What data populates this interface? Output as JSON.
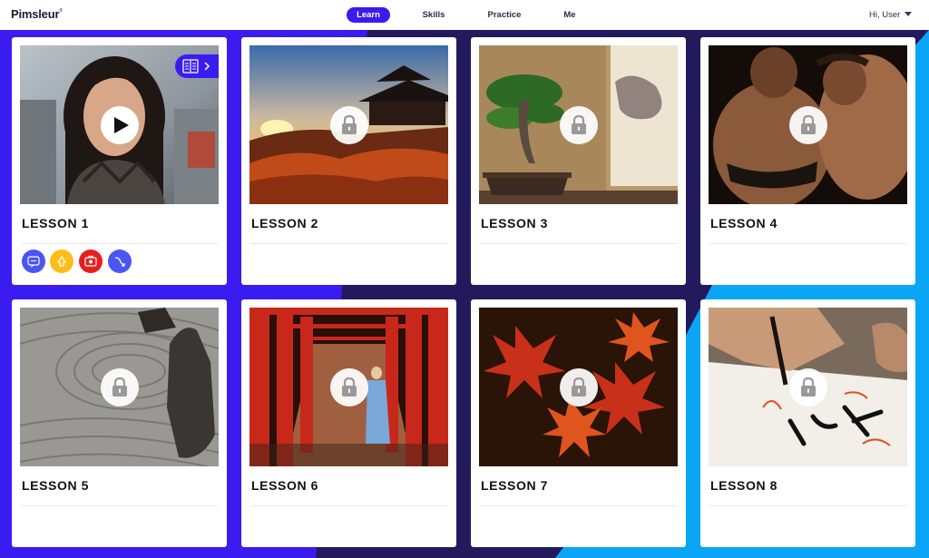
{
  "app": {
    "logo": "Pimsleur",
    "logo_mark": "®"
  },
  "nav": {
    "items": [
      {
        "label": "Learn",
        "active": true
      },
      {
        "label": "Skills",
        "active": false
      },
      {
        "label": "Practice",
        "active": false
      },
      {
        "label": "Me",
        "active": false
      }
    ]
  },
  "user": {
    "greeting": "Hi, User"
  },
  "colors": {
    "accent": "#3a1cf0",
    "background_violet": "#3a1cf0",
    "background_navy": "#231a5e",
    "background_sky": "#0aa5f5"
  },
  "lessons": [
    {
      "title": "LESSON 1",
      "status": "unlocked",
      "image": "woman-portrait",
      "overlay_icon": "play-icon",
      "tab_icon": "reading-icon"
    },
    {
      "title": "LESSON 2",
      "status": "locked",
      "image": "temple-at-sunset",
      "overlay_icon": "lock-icon"
    },
    {
      "title": "LESSON 3",
      "status": "locked",
      "image": "bonsai-tree",
      "overlay_icon": "lock-icon"
    },
    {
      "title": "LESSON 4",
      "status": "locked",
      "image": "sumo-wrestlers",
      "overlay_icon": "lock-icon"
    },
    {
      "title": "LESSON 5",
      "status": "locked",
      "image": "zen-rock-garden",
      "overlay_icon": "lock-icon"
    },
    {
      "title": "LESSON 6",
      "status": "locked",
      "image": "torii-gate-path",
      "overlay_icon": "lock-icon"
    },
    {
      "title": "LESSON 7",
      "status": "locked",
      "image": "red-maple-leaves",
      "overlay_icon": "lock-icon"
    },
    {
      "title": "LESSON 8",
      "status": "locked",
      "image": "calligraphy-brush",
      "overlay_icon": "lock-icon"
    }
  ],
  "lesson1_activities": [
    {
      "icon": "flash-cards-icon",
      "color": "#4b55f5"
    },
    {
      "icon": "quick-match-icon",
      "color": "#ffbd1a"
    },
    {
      "icon": "speak-easy-icon",
      "color": "#e81e1e"
    },
    {
      "icon": "review-icon",
      "color": "#4b55f5"
    }
  ]
}
